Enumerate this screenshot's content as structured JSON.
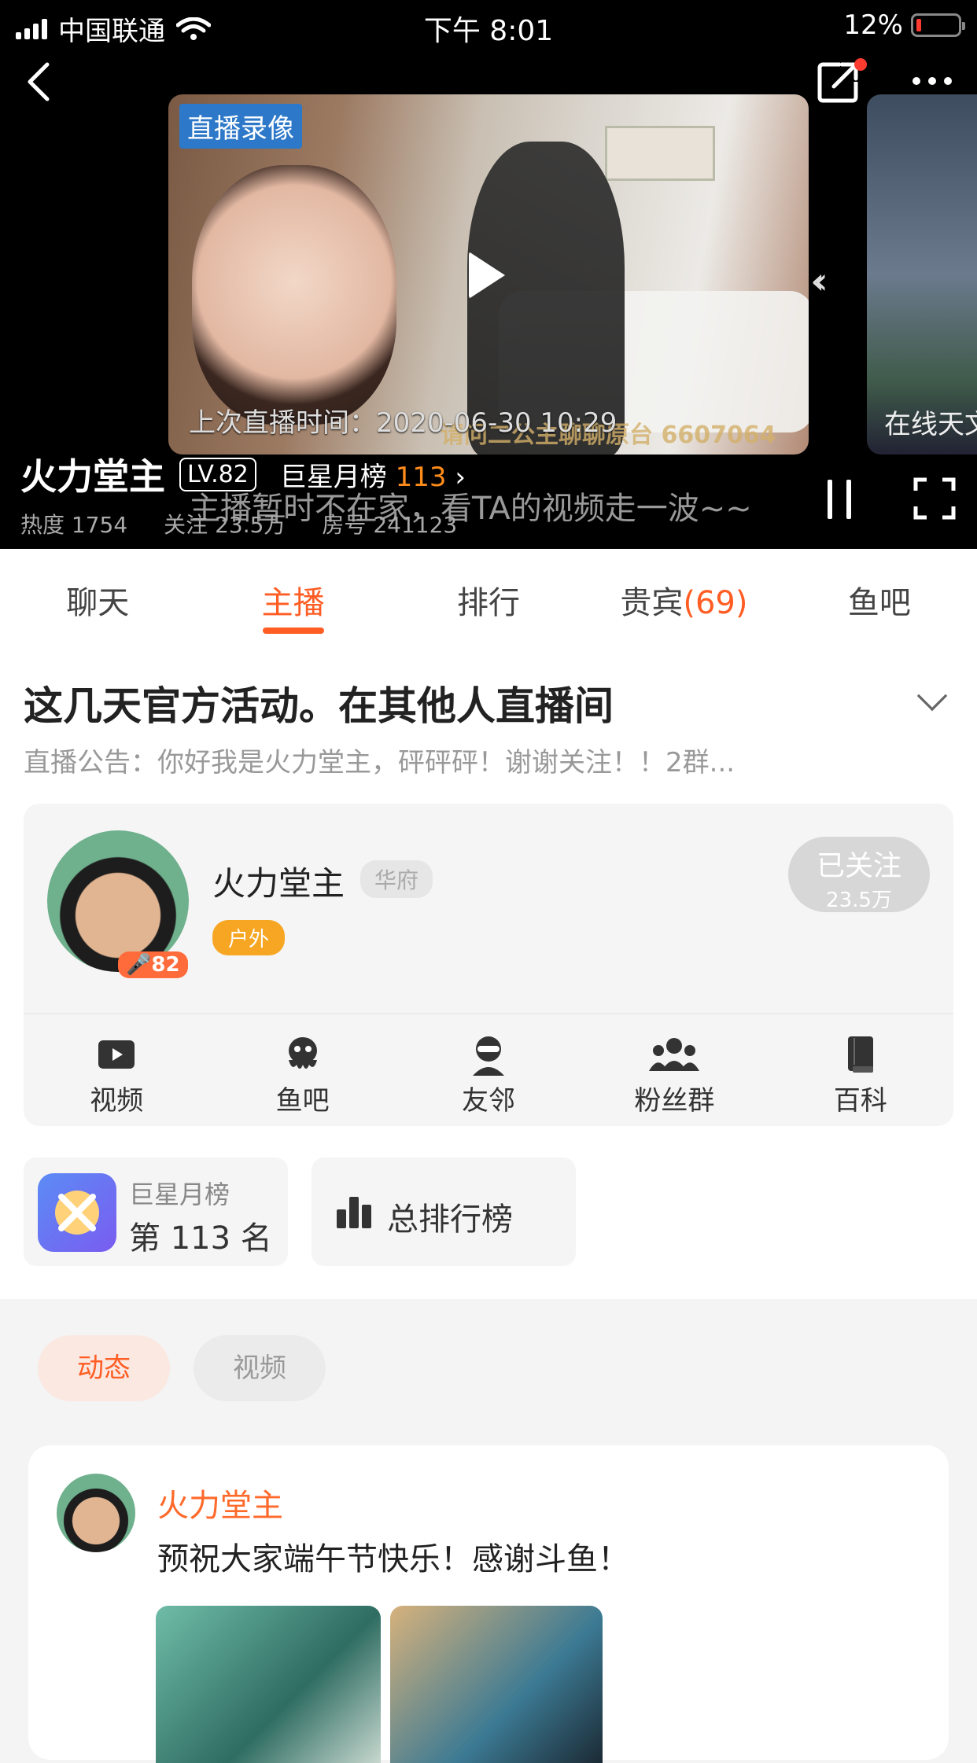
{
  "status_bar": {
    "carrier": "中国联通",
    "time": "下午 8:01",
    "battery": "12%"
  },
  "player": {
    "replay_tag": "直播录像",
    "last_live": "上次直播时间：2020-06-30 10:29",
    "watermark": "请问二公主聊聊原台 6607064",
    "side_label": "在线天文",
    "anchor_name": "火力堂主",
    "level": "LV.82",
    "star_rank_label": "巨星月榜",
    "star_rank_value": "113",
    "away_message": "主播暂时不在家，看TA的视频走一波~~",
    "stats": {
      "heat": "热度 1754",
      "follow": "关注 23.5万",
      "room": "房号 241123"
    }
  },
  "tabs": [
    {
      "label": "聊天"
    },
    {
      "label": "主播"
    },
    {
      "label": "排行"
    },
    {
      "label": "贵宾",
      "count": "(69)"
    },
    {
      "label": "鱼吧"
    }
  ],
  "anchor_page": {
    "headline": "这几天官方活动。在其他人直播间",
    "notice": "直播公告：你好我是火力堂主，砰砰砰！谢谢关注！！2群...",
    "card": {
      "name": "火力堂主",
      "region_tag": "华府",
      "category_tag": "户外",
      "avatar_level": "82",
      "follow_label": "已关注",
      "follow_count": "23.5万"
    },
    "shortcuts": [
      {
        "label": "视频",
        "icon": "video-icon"
      },
      {
        "label": "鱼吧",
        "icon": "fishbar-icon"
      },
      {
        "label": "友邻",
        "icon": "friend-icon"
      },
      {
        "label": "粉丝群",
        "icon": "fans-group-icon"
      },
      {
        "label": "百科",
        "icon": "book-icon"
      }
    ],
    "rank_monthly": {
      "title": "巨星月榜",
      "value": "第 113 名"
    },
    "rank_total": {
      "label": "总排行榜"
    }
  },
  "feed": {
    "pills": [
      {
        "label": "动态"
      },
      {
        "label": "视频"
      }
    ],
    "post": {
      "author": "火力堂主",
      "text": "预祝大家端午节快乐！感谢斗鱼！"
    }
  },
  "colors": {
    "accent": "#ff5d23",
    "rank_gold": "#ff8c1a",
    "tag_orange": "#f6a623"
  }
}
